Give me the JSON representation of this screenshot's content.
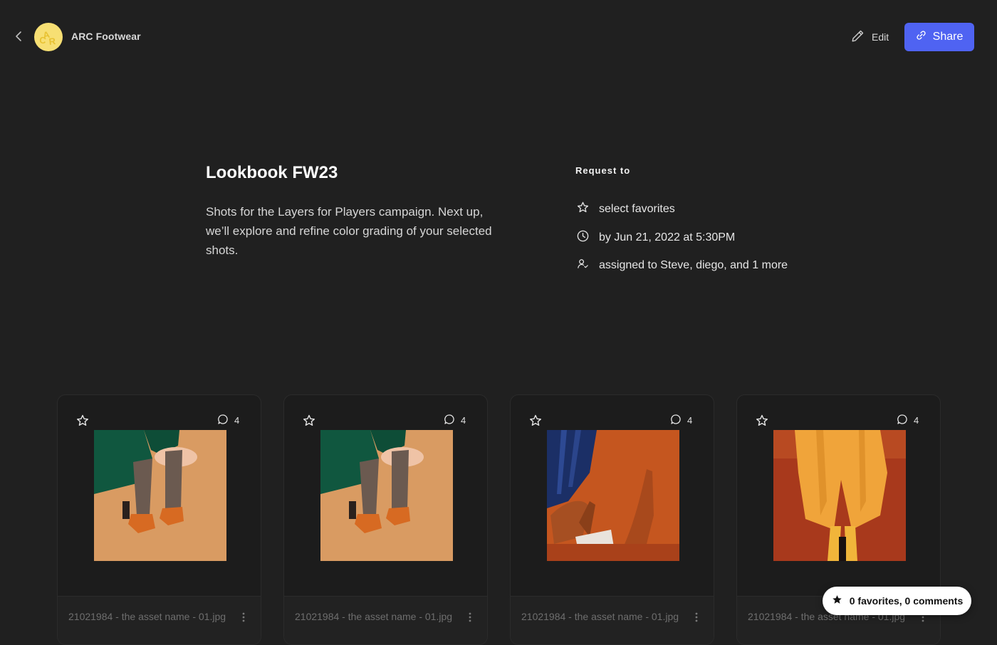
{
  "header": {
    "brand_name": "ARC Footwear",
    "logo_text": "ARC",
    "edit_label": "Edit",
    "share_label": "Share",
    "colors": {
      "logo_bg": "#f7df73",
      "accent": "#4f63f2"
    }
  },
  "project": {
    "title": "Lookbook FW23",
    "description": "Shots for the Layers for Players campaign. Next up, we’ll explore and refine color grading of your selected shots."
  },
  "request": {
    "label": "Request to",
    "items": [
      {
        "icon": "star-outline-icon",
        "text": "select favorites"
      },
      {
        "icon": "clock-icon",
        "text": "by Jun 21, 2022 at 5:30PM"
      },
      {
        "icon": "user-check-icon",
        "text": "assigned to Steve, diego, and 1 more"
      }
    ]
  },
  "assets": [
    {
      "comments": "4",
      "filename": "21021984 - the asset name - 01.jpg"
    },
    {
      "comments": "4",
      "filename": "21021984 - the asset name - 01.jpg"
    },
    {
      "comments": "4",
      "filename": "21021984 - the asset name - 01.jpg"
    },
    {
      "comments": "4",
      "filename": "21021984 - the asset name - 01.jpg"
    }
  ],
  "summary": {
    "text": "0 favorites, 0 comments"
  }
}
